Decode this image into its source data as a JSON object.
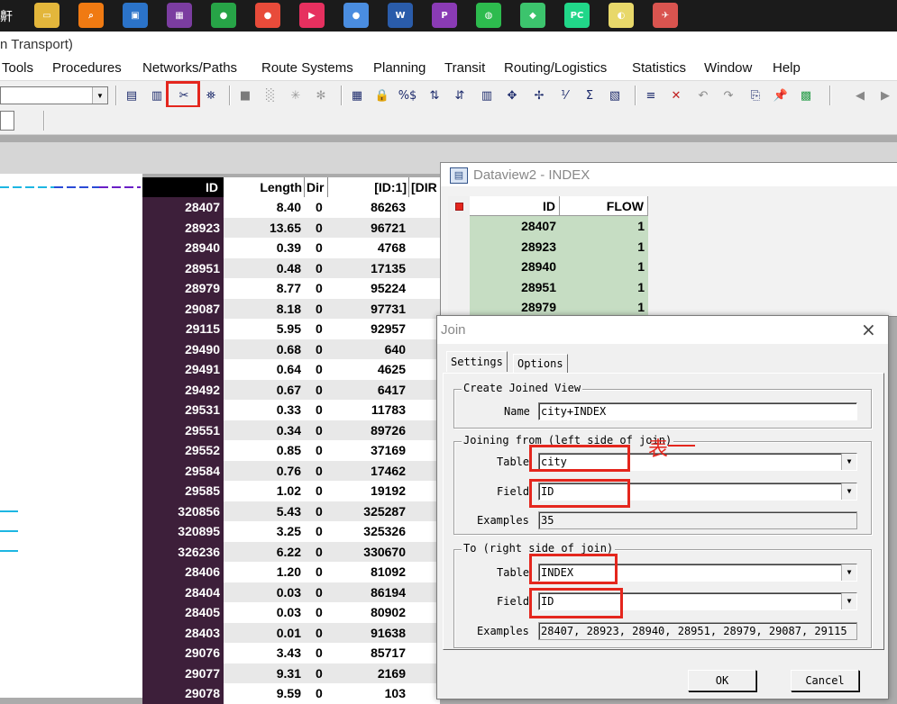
{
  "taskbar": {
    "left_glyph": "鼾",
    "icons": [
      {
        "name": "file-explorer-icon",
        "color": "#e3b63b",
        "glyph": "▭"
      },
      {
        "name": "search-app-icon",
        "color": "#f07a12",
        "glyph": "⌕"
      },
      {
        "name": "remote-desktop-icon",
        "color": "#2b73c9",
        "glyph": "▣"
      },
      {
        "name": "transcad-app-icon",
        "color": "#7b3da0",
        "glyph": "▦"
      },
      {
        "name": "chrome-user-icon",
        "color": "#27a447",
        "glyph": "●"
      },
      {
        "name": "chrome-icon",
        "color": "#e84b3a",
        "glyph": "●"
      },
      {
        "name": "media-player-icon",
        "color": "#e6305f",
        "glyph": "▶"
      },
      {
        "name": "chrome-profile-icon",
        "color": "#4a8de0",
        "glyph": "●"
      },
      {
        "name": "word-icon",
        "color": "#2a5caa",
        "glyph": "W"
      },
      {
        "name": "pdf-tool-icon",
        "color": "#8a3bb5",
        "glyph": "P"
      },
      {
        "name": "wechat-icon",
        "color": "#2dbb4e",
        "glyph": "◍"
      },
      {
        "name": "app-bag-icon",
        "color": "#3cc46d",
        "glyph": "◆"
      },
      {
        "name": "pycharm-icon",
        "color": "#21d789",
        "glyph": "PC"
      },
      {
        "name": "sticky-app-icon",
        "color": "#e8d86a",
        "glyph": "◐"
      },
      {
        "name": "network-app-icon",
        "color": "#d9544f",
        "glyph": "✈"
      }
    ]
  },
  "title": "n Transport)",
  "menu": [
    "Tools",
    "Procedures",
    "Networks/Paths",
    "Route Systems",
    "Planning",
    "Transit",
    "Routing/Logistics",
    "Statistics",
    "Window",
    "Help"
  ],
  "dataview1": {
    "headers": {
      "id": "ID",
      "length": "Length",
      "dir": "Dir",
      "id1": "[ID:1]",
      "dir2": "[DIR"
    },
    "rows": [
      [
        "28407",
        "8.40",
        "0",
        "86263"
      ],
      [
        "28923",
        "13.65",
        "0",
        "96721"
      ],
      [
        "28940",
        "0.39",
        "0",
        "4768"
      ],
      [
        "28951",
        "0.48",
        "0",
        "17135"
      ],
      [
        "28979",
        "8.77",
        "0",
        "95224"
      ],
      [
        "29087",
        "8.18",
        "0",
        "97731"
      ],
      [
        "29115",
        "5.95",
        "0",
        "92957"
      ],
      [
        "29490",
        "0.68",
        "0",
        "640"
      ],
      [
        "29491",
        "0.64",
        "0",
        "4625"
      ],
      [
        "29492",
        "0.67",
        "0",
        "6417"
      ],
      [
        "29531",
        "0.33",
        "0",
        "11783"
      ],
      [
        "29551",
        "0.34",
        "0",
        "89726"
      ],
      [
        "29552",
        "0.85",
        "0",
        "37169"
      ],
      [
        "29584",
        "0.76",
        "0",
        "17462"
      ],
      [
        "29585",
        "1.02",
        "0",
        "19192"
      ],
      [
        "320856",
        "5.43",
        "0",
        "325287"
      ],
      [
        "320895",
        "3.25",
        "0",
        "325326"
      ],
      [
        "326236",
        "6.22",
        "0",
        "330670"
      ],
      [
        "28406",
        "1.20",
        "0",
        "81092"
      ],
      [
        "28404",
        "0.03",
        "0",
        "86194"
      ],
      [
        "28405",
        "0.03",
        "0",
        "80902"
      ],
      [
        "28403",
        "0.01",
        "0",
        "91638"
      ],
      [
        "29076",
        "3.43",
        "0",
        "85717"
      ],
      [
        "29077",
        "9.31",
        "0",
        "2169"
      ],
      [
        "29078",
        "9.59",
        "0",
        "103"
      ]
    ]
  },
  "dataview2": {
    "title": "Dataview2 - INDEX",
    "headers": {
      "id": "ID",
      "flow": "FLOW"
    },
    "rows": [
      [
        "28407",
        "1"
      ],
      [
        "28923",
        "1"
      ],
      [
        "28940",
        "1"
      ],
      [
        "28951",
        "1"
      ],
      [
        "28979",
        "1"
      ]
    ]
  },
  "join": {
    "title": "Join",
    "tabs": [
      "Settings",
      "Options"
    ],
    "create_group": "Create Joined View",
    "name_label": "Name",
    "name_value": "city+INDEX",
    "left_group": "Joining from (left side of join)",
    "left_table_label": "Table",
    "left_table_value": "city",
    "left_field_label": "Field",
    "left_field_value": "ID",
    "left_examples_label": "Examples",
    "left_examples_value": "35",
    "right_group": "To (right side of join)",
    "right_table_label": "Table",
    "right_field_label": "Field",
    "right_table_value": "INDEX",
    "right_field_value": "ID",
    "right_examples_label": "Examples",
    "right_examples_value": "28407, 28923, 28940, 28951, 28979, 29087, 29115",
    "annotation": "表",
    "ok": "OK",
    "cancel": "Cancel"
  },
  "colors": {
    "highlight_box": "#e4261d",
    "id_column_bg": "#3d1f3a",
    "dv2_cell_bg": "#c6ddc3",
    "legend_line": "#1db6e2"
  }
}
